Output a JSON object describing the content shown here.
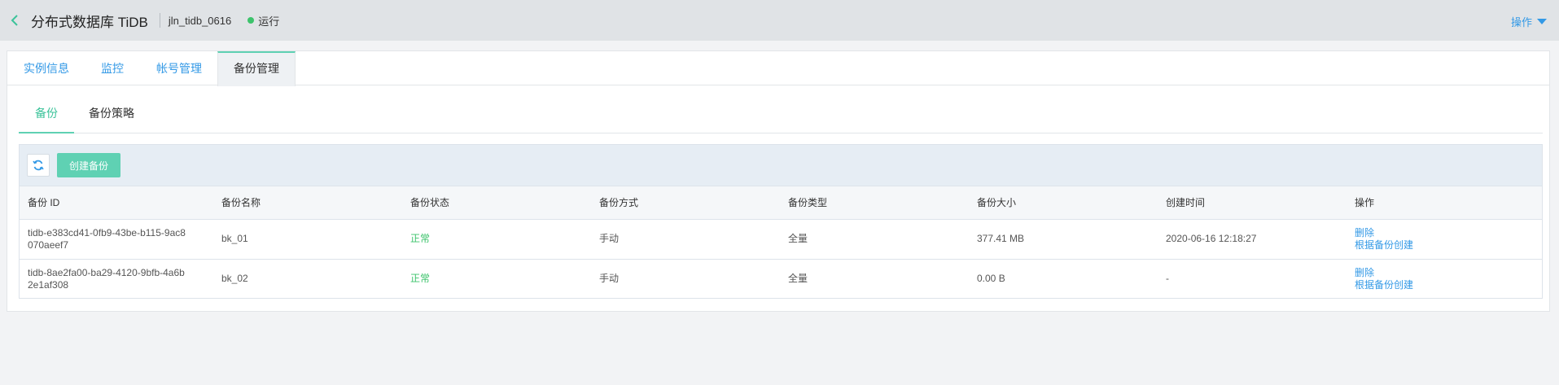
{
  "header": {
    "app_title": "分布式数据库 TiDB",
    "instance_name": "jln_tidb_0616",
    "status": "运行",
    "status_color": "#3cc36b",
    "ops_label": "操作"
  },
  "tabs": [
    {
      "label": "实例信息"
    },
    {
      "label": "监控"
    },
    {
      "label": "帐号管理"
    },
    {
      "label": "备份管理"
    }
  ],
  "subtabs": [
    {
      "label": "备份"
    },
    {
      "label": "备份策略"
    }
  ],
  "toolbar": {
    "refresh_icon": "refresh-icon",
    "create_label": "创建备份"
  },
  "table": {
    "columns": [
      "备份 ID",
      "备份名称",
      "备份状态",
      "备份方式",
      "备份类型",
      "备份大小",
      "创建时间",
      "操作"
    ],
    "rows": [
      {
        "id_line1": "tidb-e383cd41-0fb9-43be-b115-9ac8",
        "id_line2": "070aeef7",
        "name": "bk_01",
        "status": "正常",
        "method": "手动",
        "type": "全量",
        "size": "377.41 MB",
        "created": "2020-06-16 12:18:27",
        "action_delete": "删除",
        "action_restore": "根据备份创建"
      },
      {
        "id_line1": "tidb-8ae2fa00-ba29-4120-9bfb-4a6b",
        "id_line2": "2e1af308",
        "name": "bk_02",
        "status": "正常",
        "method": "手动",
        "type": "全量",
        "size": "0.00 B",
        "created": "-",
        "action_delete": "删除",
        "action_restore": "根据备份创建"
      }
    ]
  },
  "colors": {
    "accent": "#5fd1b3",
    "link": "#3399e6",
    "success": "#3cc36b"
  }
}
